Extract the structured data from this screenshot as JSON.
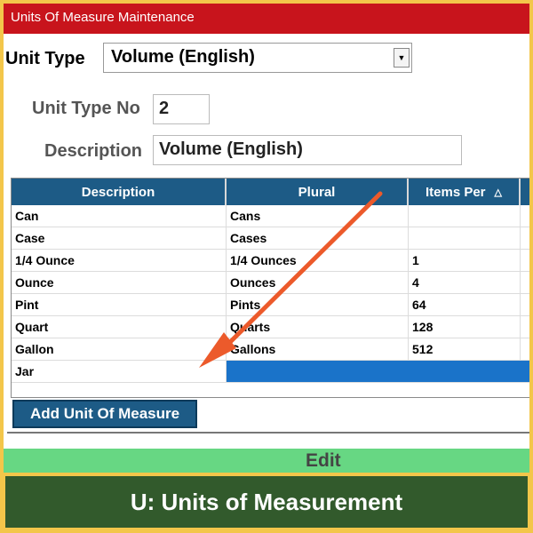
{
  "window": {
    "title": "Units Of Measure Maintenance"
  },
  "unit_type": {
    "label": "Unit Type",
    "selected": "Volume (English)"
  },
  "unit_type_no": {
    "label": "Unit Type No",
    "value": "2"
  },
  "description": {
    "label": "Description",
    "value": "Volume (English)"
  },
  "grid": {
    "columns": [
      "Description",
      "Plural",
      "Items Per"
    ],
    "rows": [
      {
        "description": "Can",
        "plural": "Cans",
        "items_per": ""
      },
      {
        "description": "Case",
        "plural": "Cases",
        "items_per": ""
      },
      {
        "description": "1/4 Ounce",
        "plural": "1/4 Ounces",
        "items_per": "1"
      },
      {
        "description": "Ounce",
        "plural": "Ounces",
        "items_per": "4"
      },
      {
        "description": "Pint",
        "plural": "Pints",
        "items_per": "64"
      },
      {
        "description": "Quart",
        "plural": "Quarts",
        "items_per": "128"
      },
      {
        "description": "Gallon",
        "plural": "Gallons",
        "items_per": "512"
      },
      {
        "description": "Jar",
        "plural": "",
        "items_per": ""
      }
    ]
  },
  "buttons": {
    "add_unit": "Add Unit Of Measure",
    "edit": "Edit"
  },
  "banner": {
    "caption": "U: Units of Measurement"
  },
  "colors": {
    "title_bar": "#c8141c",
    "grid_header": "#1d5b86",
    "selection": "#1a73c9",
    "annotation_arrow": "#ec5a2b",
    "banner": "#325a2c",
    "border": "#f3c64a"
  }
}
